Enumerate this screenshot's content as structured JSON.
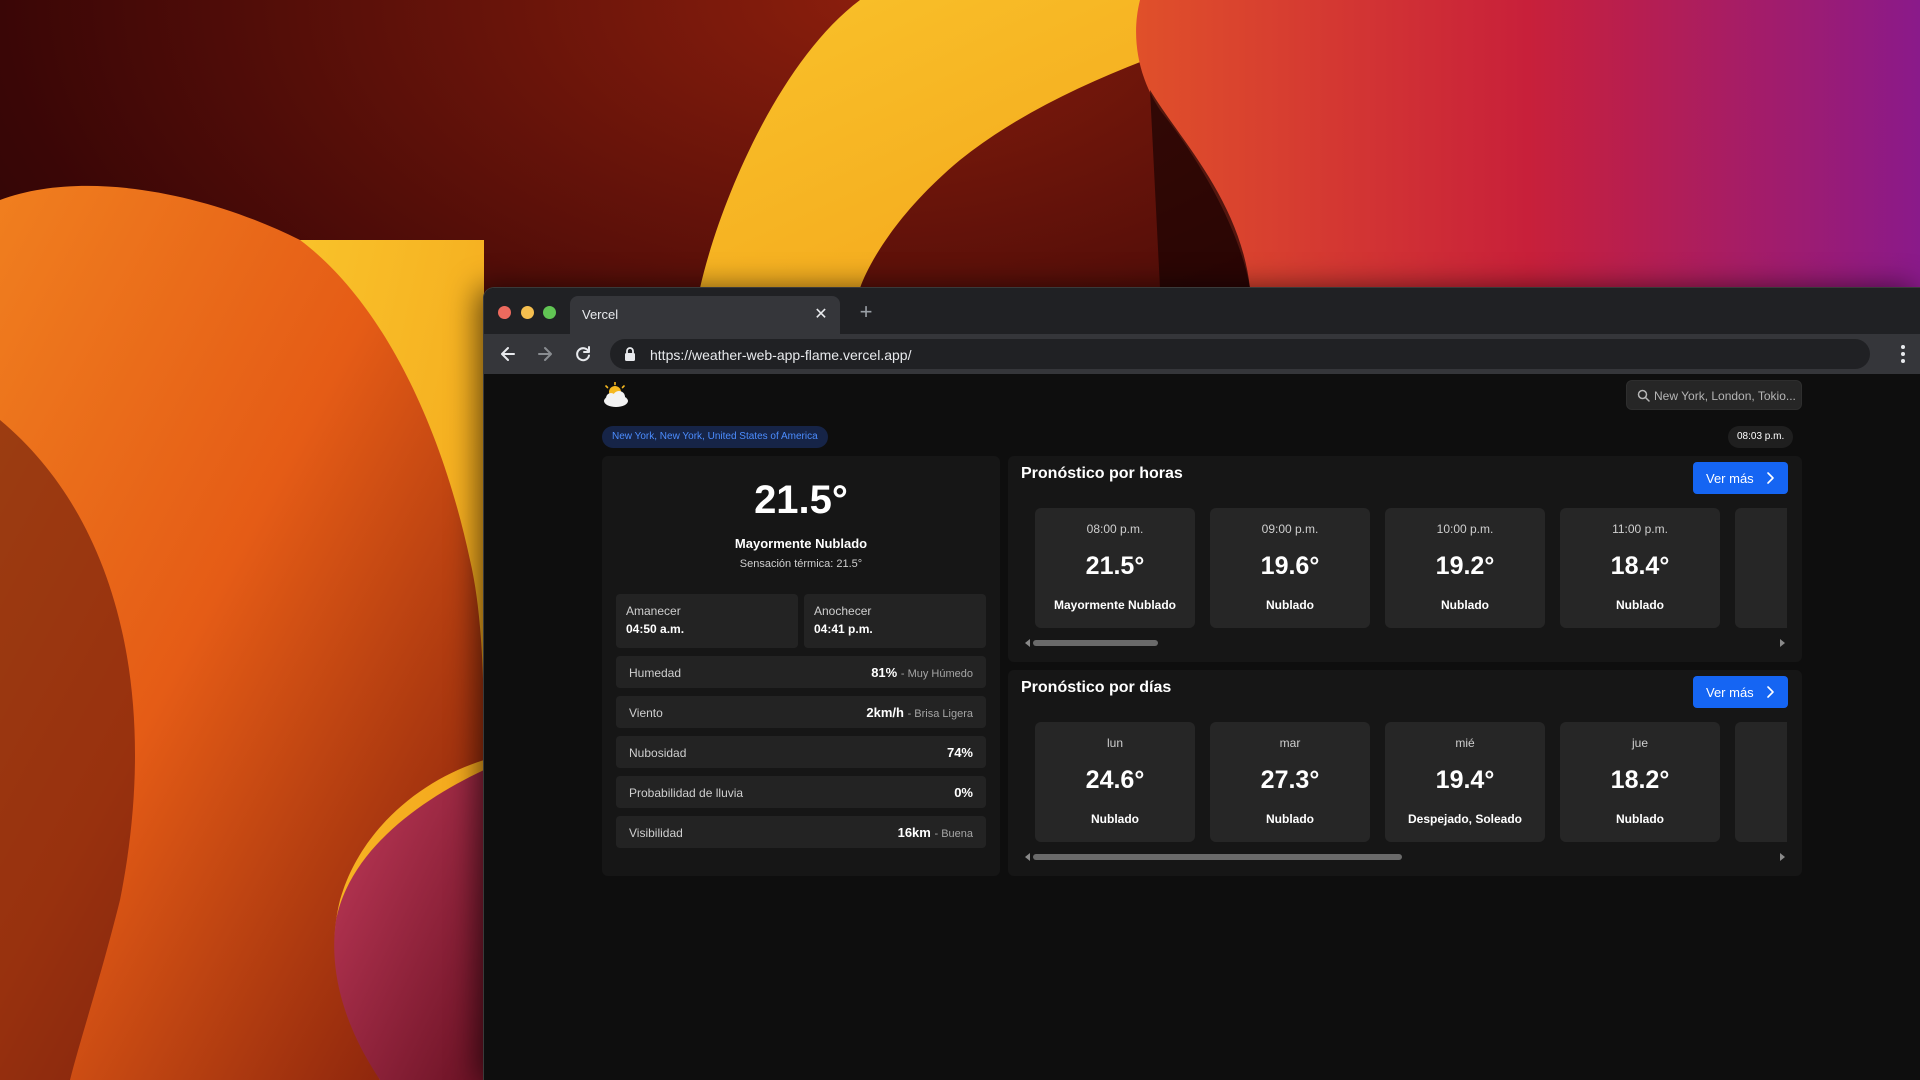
{
  "browser": {
    "tab_title": "Vercel",
    "url": "https://weather-web-app-flame.vercel.app/"
  },
  "app": {
    "search_placeholder": "New York, London, Tokio...",
    "location": "New York, New York, United States of America",
    "local_time": "08:03 p.m."
  },
  "current": {
    "temperature": "21.5°",
    "condition": "Mayormente Nublado",
    "feels_like": "Sensación térmica: 21.5°",
    "sunrise": {
      "label": "Amanecer",
      "value": "04:50 a.m."
    },
    "sunset": {
      "label": "Anochecer",
      "value": "04:41 p.m."
    },
    "stats": [
      {
        "label": "Humedad",
        "value": "81%",
        "qualifier": "- Muy Húmedo"
      },
      {
        "label": "Viento",
        "value": "2km/h",
        "qualifier": "- Brisa Ligera"
      },
      {
        "label": "Nubosidad",
        "value": "74%",
        "qualifier": ""
      },
      {
        "label": "Probabilidad de lluvia",
        "value": "0%",
        "qualifier": ""
      },
      {
        "label": "Visibilidad",
        "value": "16km",
        "qualifier": "- Buena"
      }
    ]
  },
  "hourly": {
    "title": "Pronóstico por horas",
    "more_label": "Ver más",
    "items": [
      {
        "time": "08:00 p.m.",
        "temp": "21.5°",
        "cond": "Mayormente Nublado"
      },
      {
        "time": "09:00 p.m.",
        "temp": "19.6°",
        "cond": "Nublado"
      },
      {
        "time": "10:00 p.m.",
        "temp": "19.2°",
        "cond": "Nublado"
      },
      {
        "time": "11:00 p.m.",
        "temp": "18.4°",
        "cond": "Nublado"
      }
    ],
    "scroll_position": 0.0,
    "scroll_visible_fraction": 0.17
  },
  "daily": {
    "title": "Pronóstico por días",
    "more_label": "Ver más",
    "items": [
      {
        "time": "lun",
        "temp": "24.6°",
        "cond": "Nublado"
      },
      {
        "time": "mar",
        "temp": "27.3°",
        "cond": "Nublado"
      },
      {
        "time": "mié",
        "temp": "19.4°",
        "cond": "Despejado, Soleado"
      },
      {
        "time": "jue",
        "temp": "18.2°",
        "cond": "Nublado"
      }
    ],
    "scroll_position": 0.0,
    "scroll_visible_fraction": 0.5
  },
  "colors": {
    "accent": "#1565f3",
    "location_badge_text": "#4c8dff",
    "card_bg": "#262626"
  }
}
